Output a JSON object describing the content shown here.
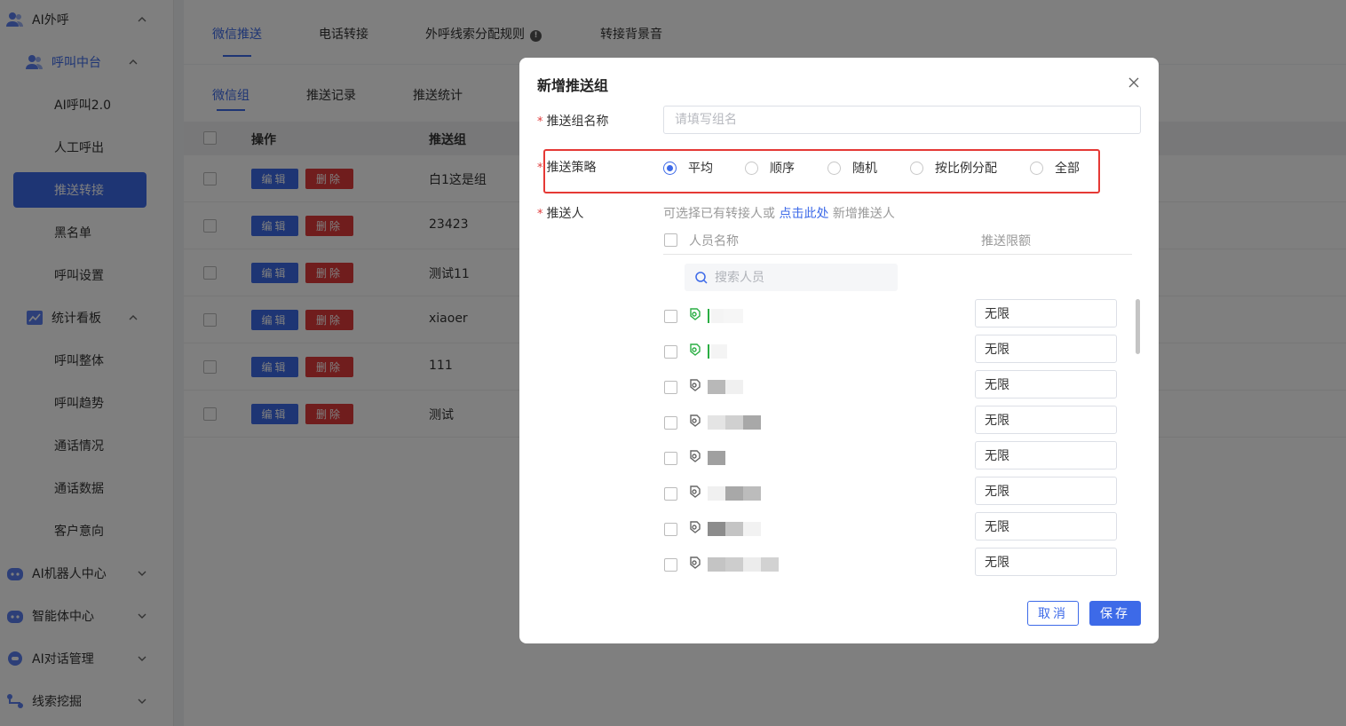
{
  "sidebar": {
    "items": [
      {
        "label": "AI外呼",
        "icon": "user-group-icon"
      },
      {
        "label": "呼叫中台",
        "icon": "user-group-icon"
      },
      {
        "label": "AI呼叫2.0"
      },
      {
        "label": "人工呼出"
      },
      {
        "label": "推送转接"
      },
      {
        "label": "黑名单"
      },
      {
        "label": "呼叫设置"
      },
      {
        "label": "统计看板",
        "icon": "chart-icon"
      },
      {
        "label": "呼叫整体"
      },
      {
        "label": "呼叫趋势"
      },
      {
        "label": "通话情况"
      },
      {
        "label": "通话数据"
      },
      {
        "label": "客户意向"
      },
      {
        "label": "AI机器人中心",
        "icon": "robot-icon"
      },
      {
        "label": "智能体中心",
        "icon": "robot-icon"
      },
      {
        "label": "AI对话管理",
        "icon": "chat-icon"
      },
      {
        "label": "线索挖掘",
        "icon": "flow-icon"
      }
    ]
  },
  "top_tabs": [
    "微信推送",
    "电话转接",
    "外呼线索分配规则",
    "转接背景音"
  ],
  "sub_tabs": [
    "微信组",
    "推送记录",
    "推送统计"
  ],
  "table": {
    "headers": [
      "操作",
      "推送组"
    ],
    "edit_label": "编辑",
    "delete_label": "删除",
    "rows": [
      "白1这是组",
      "23423",
      "测试11",
      "xiaoer",
      "111",
      "测试"
    ]
  },
  "modal": {
    "title": "新增推送组",
    "name_label": "推送组名称",
    "name_placeholder": "请填写组名",
    "strategy_label": "推送策略",
    "strategies": [
      "平均",
      "顺序",
      "随机",
      "按比例分配",
      "全部"
    ],
    "selected_strategy": "平均",
    "pusher_label": "推送人",
    "hint_prefix": "可选择已有转接人或",
    "hint_link": "点击此处",
    "hint_suffix": "新增推送人",
    "col_person": "人员名称",
    "col_quota": "推送限额",
    "search_placeholder": "搜索人员",
    "quota_values": [
      "无限",
      "无限",
      "无限",
      "无限",
      "无限",
      "无限",
      "无限",
      "无限"
    ],
    "cancel_label": "取消",
    "save_label": "保存"
  },
  "colors": {
    "primary": "#3d6ae8",
    "danger": "#e03a3a",
    "highlight_box": "#e53935",
    "wechat_green": "#2aae43"
  }
}
